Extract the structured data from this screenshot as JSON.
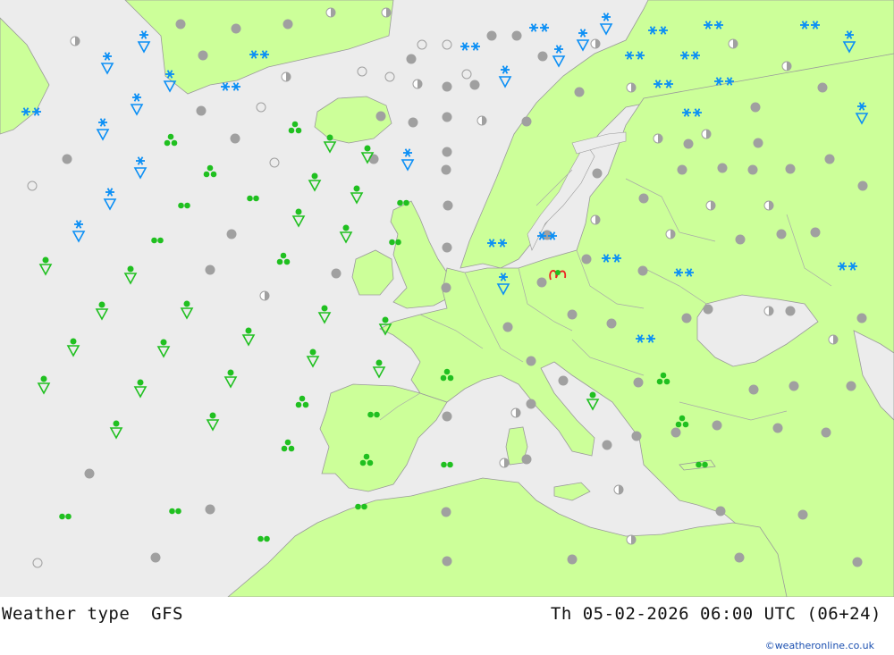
{
  "footer": {
    "title_left": "Weather type  GFS",
    "title_right": "Th 05-02-2026 06:00 UTC (06+24)",
    "credit": "©weatheronline.co.uk"
  },
  "colors": {
    "sea": "#ececec",
    "land": "#ccff99",
    "border": "#9a9a9a",
    "snow": "#0b8ff5",
    "rain": "#20c020",
    "cloud": "#a0a0a0",
    "thunder": "#ee2222"
  },
  "legend_types": [
    "overcast",
    "partly-cloudy",
    "clear",
    "snow",
    "snow-shower",
    "rain-shower",
    "drizzle",
    "showers-cluster",
    "thunderstorm"
  ]
}
